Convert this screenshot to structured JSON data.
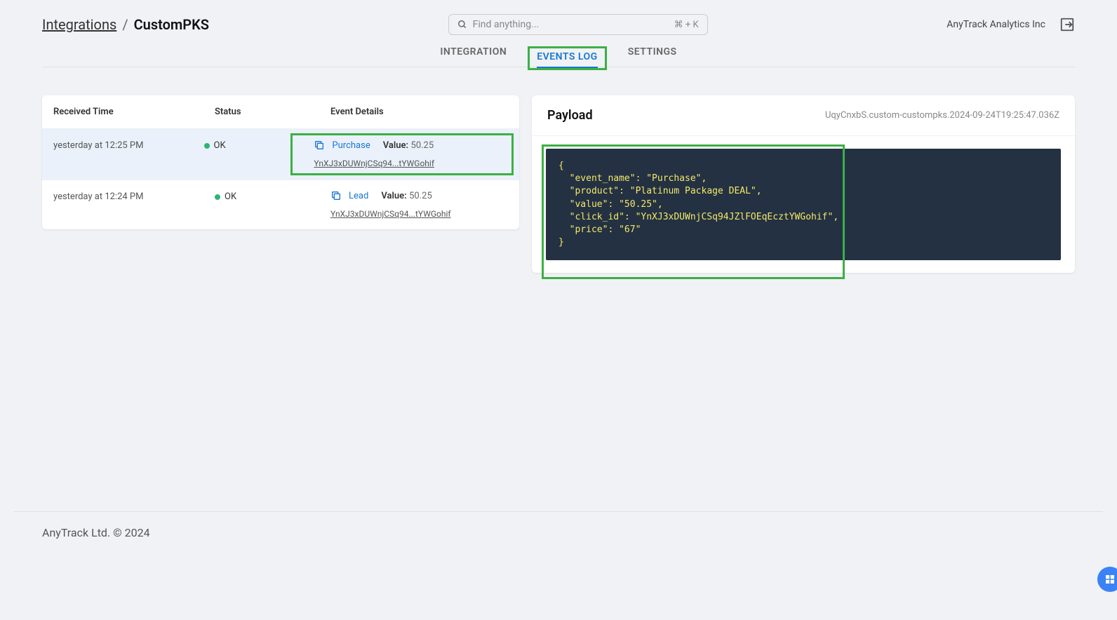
{
  "breadcrumb": {
    "root": "Integrations",
    "current": "CustomPKS"
  },
  "search": {
    "placeholder": "Find anything...",
    "shortcut": "⌘ + K"
  },
  "company_name": "AnyTrack Analytics Inc",
  "tabs": {
    "integration": "INTEGRATION",
    "events_log": "EVENTS LOG",
    "settings": "SETTINGS"
  },
  "table": {
    "headers": {
      "time": "Received Time",
      "status": "Status",
      "details": "Event Details"
    },
    "rows": [
      {
        "time": "yesterday at 12:25 PM",
        "status": "OK",
        "event": "Purchase",
        "value_label": "Value:",
        "value": "50.25",
        "click_id": "YnXJ3xDUWnjCSq94...tYWGohif"
      },
      {
        "time": "yesterday at 12:24 PM",
        "status": "OK",
        "event": "Lead",
        "value_label": "Value:",
        "value": "50.25",
        "click_id": "YnXJ3xDUWnjCSq94...tYWGohif"
      }
    ]
  },
  "payload": {
    "title": "Payload",
    "id": "UqyCnxbS.custom-custompks.2024-09-24T19:25:47.036Z",
    "code": "{\n  \"event_name\": \"Purchase\",\n  \"product\": \"Platinum Package DEAL\",\n  \"value\": \"50.25\",\n  \"click_id\": \"YnXJ3xDUWnjCSq94JZlFOEqEcztYWGohif\",\n  \"price\": \"67\"\n}"
  },
  "footer": "AnyTrack Ltd. © 2024"
}
